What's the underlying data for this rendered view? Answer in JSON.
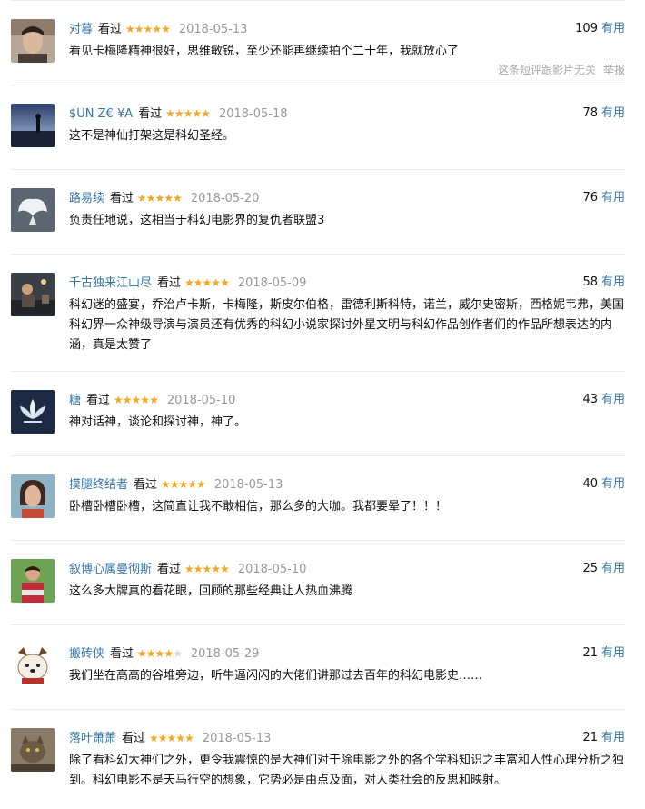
{
  "comments": [
    {
      "user": "对暮",
      "watched_label": "看过",
      "rating": 5,
      "date": "2018-05-13",
      "votes": "109",
      "useful_label": "有用",
      "text": "看见卡梅隆精神很好，思维敏锐，至少还能再继续拍个二十年，我就放心了",
      "unrelated_label": "这条短评跟影片无关",
      "report_label": "举报",
      "avatar_icon": "man-portrait-avatar"
    },
    {
      "user": "$UN Z€ ¥A",
      "watched_label": "看过",
      "rating": 5,
      "date": "2018-05-18",
      "votes": "78",
      "useful_label": "有用",
      "text": "这不是神仙打架这是科幻圣经。",
      "avatar_icon": "sunset-silhouette-avatar"
    },
    {
      "user": "路易续",
      "watched_label": "看过",
      "rating": 5,
      "date": "2018-05-20",
      "votes": "76",
      "useful_label": "有用",
      "text": "负责任地说，这相当于科幻电影界的复仇者联盟3",
      "avatar_icon": "white-wings-avatar"
    },
    {
      "user": "千古独来江山尽",
      "watched_label": "看过",
      "rating": 5,
      "date": "2018-05-09",
      "votes": "58",
      "useful_label": "有用",
      "text": "科幻迷的盛宴，乔治卢卡斯，卡梅隆，斯皮尔伯格，雷德利斯科特，诺兰，威尔史密斯，西格妮韦弗，美国科幻界一众神级导演与演员还有优秀的科幻小说家探讨外星文明与科幻作品创作者们的作品所想表达的内涵，真是太赞了",
      "avatar_icon": "street-night-avatar"
    },
    {
      "user": "糖",
      "watched_label": "看过",
      "rating": 5,
      "date": "2018-05-10",
      "votes": "43",
      "useful_label": "有用",
      "text": "神对话神，谈论和探讨神，神了。",
      "avatar_icon": "lotus-avatar"
    },
    {
      "user": "摸腿终结者",
      "watched_label": "看过",
      "rating": 5,
      "date": "2018-05-13",
      "votes": "40",
      "useful_label": "有用",
      "text": "卧槽卧槽卧槽，这简直让我不敢相信，那么多的大咖。我都要晕了！！！",
      "avatar_icon": "woman-portrait-avatar"
    },
    {
      "user": "叙博心属曼彻斯",
      "watched_label": "看过",
      "rating": 5,
      "date": "2018-05-10",
      "votes": "25",
      "useful_label": "有用",
      "text": "这么多大牌真的看花眼，回顾的那些经典让人热血沸腾",
      "avatar_icon": "football-player-avatar"
    },
    {
      "user": "搬砖侠",
      "watched_label": "看过",
      "rating": 4,
      "date": "2018-05-29",
      "votes": "21",
      "useful_label": "有用",
      "text": "我们坐在高高的谷堆旁边，听牛逼闪闪的大佬们讲那过去百年的科幻电影史……",
      "avatar_icon": "cartoon-dog-avatar"
    },
    {
      "user": "落叶萧萧",
      "watched_label": "看过",
      "rating": 5,
      "date": "2018-05-13",
      "votes": "21",
      "useful_label": "有用",
      "text": "除了看科幻大神们之外，更令我震惊的是大神们对于除电影之外的各个学科知识之丰富和人性心理分析之独到。科幻电影不是天马行空的想象，它势必是由点及面，对人类社会的反思和映射。",
      "avatar_icon": "cat-avatar"
    }
  ]
}
